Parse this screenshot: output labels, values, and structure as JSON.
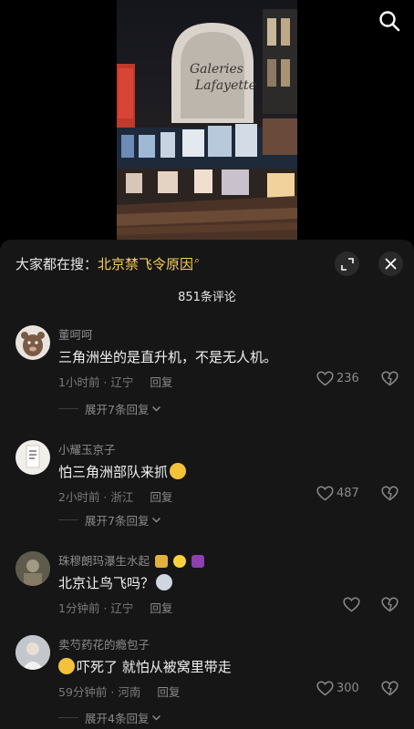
{
  "header": {
    "search_icon": "search-icon"
  },
  "sheet": {
    "search_prefix": "大家都在搜：",
    "search_keyword": "北京禁飞令原因",
    "search_glyph": "magnifier-icon",
    "comment_count": "851条评论",
    "expand_icon": "expand-icon",
    "close_icon": "close-icon"
  },
  "comments": [
    {
      "user": "董呵呵",
      "text": "三角洲坐的是直升机，不是无人机。",
      "time": "1小时前 · 辽宁",
      "reply_label": "回复",
      "likes": "236",
      "replies_label": "展开7条回复"
    },
    {
      "user": "小耀玉京子",
      "text": "怕三角洲部队来抓",
      "text_emoji": "crying-laughing-emoji",
      "time": "2小时前 · 浙江",
      "reply_label": "回复",
      "likes": "487",
      "replies_label": "展开7条回复"
    },
    {
      "user": "珠穆朗玛瀑生水起",
      "user_emoji": [
        "money-bag-emoji",
        "chick-emoji",
        "scorpio-emoji"
      ],
      "text": "北京让鸟飞吗？",
      "text_emoji": "cat-emoji",
      "time": "1分钟前 · 辽宁",
      "reply_label": "回复",
      "likes": ""
    },
    {
      "user": "卖芍药花的瘾包子",
      "text_prefix_emoji": "crying-laughing-emoji",
      "text": "吓死了 就怕从被窝里带走",
      "time": "59分钟前 · 河南",
      "reply_label": "回复",
      "likes": "300",
      "replies_label": "展开4条回复"
    }
  ],
  "colors": {
    "sheet_bg": "#161616",
    "keyword": "#f7cf53",
    "muted": "#8a8a8a"
  }
}
